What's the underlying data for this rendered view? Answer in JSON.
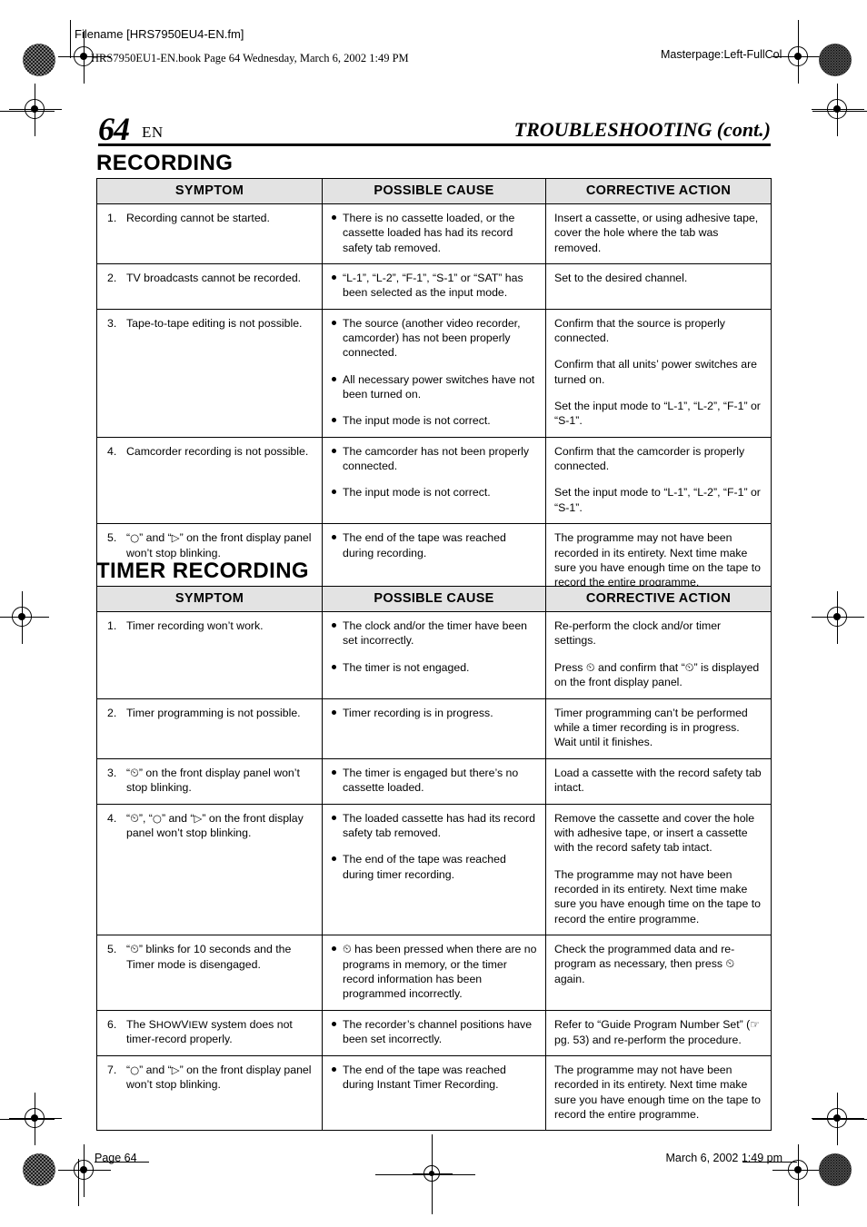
{
  "print_marks": {
    "filename_label": "Filename [HRS7950EU4-EN.fm]",
    "book_line": "HRS7950EU1-EN.book  Page 64  Wednesday, March 6, 2002  1:49 PM",
    "masterpage": "Masterpage:Left-FullCol"
  },
  "header": {
    "page_number": "64",
    "language_code": "EN",
    "chapter_title": "TROUBLESHOOTING (cont.)"
  },
  "glyphs": {
    "bullet": "●",
    "circle": "○",
    "play": "▷",
    "timer": "⏲",
    "hand_pointer": "☞"
  },
  "sections": [
    {
      "heading": "RECORDING",
      "columns": [
        "SYMPTOM",
        "POSSIBLE CAUSE",
        "CORRECTIVE ACTION"
      ],
      "rows": [
        {
          "num": "1.",
          "symptom": "Recording cannot be started.",
          "causes": [
            "There is no cassette loaded, or the cassette loaded has had its record safety tab removed."
          ],
          "actions": [
            "Insert a cassette, or using adhesive tape, cover the hole where the tab was removed."
          ]
        },
        {
          "num": "2.",
          "symptom": "TV broadcasts cannot be recorded.",
          "causes": [
            "“L-1”, “L-2”, “F-1”, “S-1” or “SAT” has been selected as the input mode."
          ],
          "actions": [
            "Set to the desired channel."
          ]
        },
        {
          "num": "3.",
          "symptom": "Tape-to-tape editing is not possible.",
          "causes": [
            "The source (another video recorder, camcorder) has not been properly connected.",
            "All necessary power switches have not been turned on.",
            "The input mode is not correct."
          ],
          "actions": [
            "Confirm that the source is properly connected.",
            "Confirm that all units’ power switches are turned on.",
            "Set the input mode to “L-1”, “L-2”, “F-1” or “S-1”."
          ]
        },
        {
          "num": "4.",
          "symptom": "Camcorder recording is not possible.",
          "causes": [
            "The camcorder has not been properly connected.",
            "The input mode is not correct."
          ],
          "actions": [
            "Confirm that the camcorder is properly connected.",
            "Set the input mode to “L-1”, “L-2”, “F-1” or “S-1”."
          ]
        },
        {
          "num": "5.",
          "symptom_pre": "“",
          "symptom_mid": "” and “",
          "symptom_post": "” on the front display panel won’t stop blinking.",
          "symptom": "“○” and “▷” on the front display panel won’t stop blinking.",
          "causes": [
            "The end of the tape was reached during recording."
          ],
          "actions": [
            "The programme may not have been recorded in its entirety. Next time make sure you have enough time on the tape to record the entire programme."
          ]
        }
      ]
    },
    {
      "heading": "TIMER RECORDING",
      "columns": [
        "SYMPTOM",
        "POSSIBLE CAUSE",
        "CORRECTIVE ACTION"
      ],
      "rows": [
        {
          "num": "1.",
          "symptom": "Timer recording won’t work.",
          "causes": [
            "The clock and/or the timer have been set incorrectly.",
            "The timer is not engaged."
          ],
          "actions": [
            "Re-perform the clock and/or timer settings.",
            "Press ⏲ and confirm that “⏲” is displayed on the front display panel."
          ],
          "action_parts": [
            {
              "text": "Re-perform the clock and/or timer settings."
            },
            {
              "a": "Press ",
              "g1": "⏲",
              "b": " and confirm that “",
              "g2": "⏲",
              "c": "” is displayed on the front display panel."
            }
          ]
        },
        {
          "num": "2.",
          "symptom": "Timer programming is not possible.",
          "causes": [
            "Timer recording is in progress."
          ],
          "actions": [
            "Timer programming can’t be performed while a timer recording is in progress. Wait until it finishes."
          ]
        },
        {
          "num": "3.",
          "symptom": "“⏲” on the front display panel won’t stop blinking.",
          "symptom_post": "” on the front display panel won’t stop blinking.",
          "causes": [
            "The timer is engaged but there’s no cassette loaded."
          ],
          "actions": [
            "Load a cassette with the record safety tab intact."
          ]
        },
        {
          "num": "4.",
          "symptom": "“⏲”, “○” and “▷” on the front display panel won’t stop blinking.",
          "causes": [
            "The loaded cassette has had its record safety tab removed.",
            "The end of the tape was reached during timer recording."
          ],
          "actions": [
            "Remove the cassette and cover the hole with adhesive tape, or insert a cassette with the record safety tab intact.",
            "The programme may not have been recorded in its entirety. Next time make sure you have enough time on the tape to record the entire programme."
          ]
        },
        {
          "num": "5.",
          "symptom": "“⏲” blinks for 10 seconds and the Timer mode is disengaged.",
          "symptom_post": "” blinks for 10 seconds and the Timer mode is disengaged.",
          "causes": [
            "⏲ has been pressed when there are no programs in memory, or the timer record information has been programmed incorrectly."
          ],
          "cause_parts": [
            {
              "g1": "⏲",
              "b": " has been pressed when there are no programs in memory, or the timer record information has been programmed incorrectly."
            }
          ],
          "actions": [
            "Check the programmed data and re-program as necessary, then press ⏲ again."
          ],
          "action_parts": [
            {
              "a": "Check the programmed data and re-program as necessary, then press ",
              "g1": "⏲",
              "b": " again."
            }
          ]
        },
        {
          "num": "6.",
          "symptom": "The SHOWVIEW system does not timer-record properly.",
          "symptom_a": "The S",
          "symptom_sc1": "HOW",
          "symptom_b": "V",
          "symptom_sc2": "IEW",
          "symptom_c": " system does not timer-record properly.",
          "causes": [
            "The recorder’s channel positions have been set incorrectly."
          ],
          "actions": [
            "Refer to “Guide Program Number Set” (☞ pg. 53) and re-perform the procedure."
          ],
          "action_parts": [
            {
              "a": "Refer to “Guide Program Number Set” (",
              "g1": "☞",
              "b": " pg. 53) and re-perform the procedure."
            }
          ]
        },
        {
          "num": "7.",
          "symptom": "“○” and “▷” on the front display panel won’t stop blinking.",
          "causes": [
            "The end of the tape was reached during Instant Timer Recording."
          ],
          "actions": [
            "The programme may not have been recorded in its entirety. Next time make sure you have enough time on the tape to record the entire programme."
          ]
        }
      ]
    }
  ],
  "footer": {
    "page_label": "Page 64",
    "timestamp": "March 6, 2002 1:49 pm"
  }
}
